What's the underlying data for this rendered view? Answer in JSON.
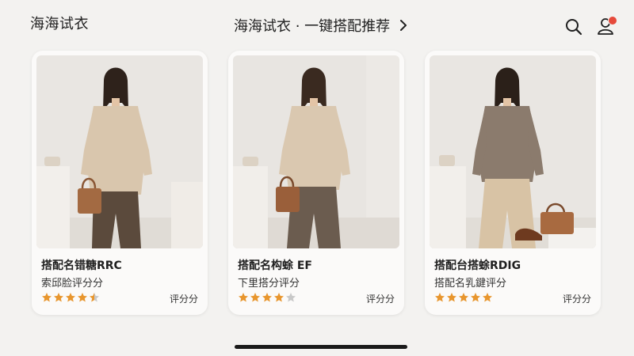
{
  "header": {
    "app_title": "海海试衣",
    "center_title": "海海试衣 · 一键搭配推荐",
    "chevron_icon": "chevron-right-icon",
    "search_icon": "search-icon",
    "profile_icon": "profile-icon",
    "badge_color": "#e64a3b"
  },
  "cards": [
    {
      "name": "搭配名错糖RRC",
      "subtitle": "索邱脸评分分",
      "rating_label": "评分分",
      "stars": 4.5,
      "top_color": "#d9c6ad",
      "pants_color": "#5b4a3c",
      "has_bag": true,
      "has_shoes": false
    },
    {
      "name": "搭配名构蜍 EF",
      "subtitle": "下里搭分评分",
      "rating_label": "评分分",
      "stars": 4,
      "top_color": "#dac8b0",
      "pants_color": "#6b5c4f",
      "has_bag": true,
      "has_shoes": false
    },
    {
      "name": "搭配台搭蜍RDIG",
      "subtitle": "搭配名乳鍵评分",
      "rating_label": "评分分",
      "stars": 5,
      "top_color": "#8b7b6d",
      "pants_color": "#d8c3a5",
      "has_bag": true,
      "has_shoes": true
    }
  ],
  "colors": {
    "star_filled": "#e8962e",
    "star_empty": "#c8c8c8",
    "background": "#f3f2f0"
  }
}
